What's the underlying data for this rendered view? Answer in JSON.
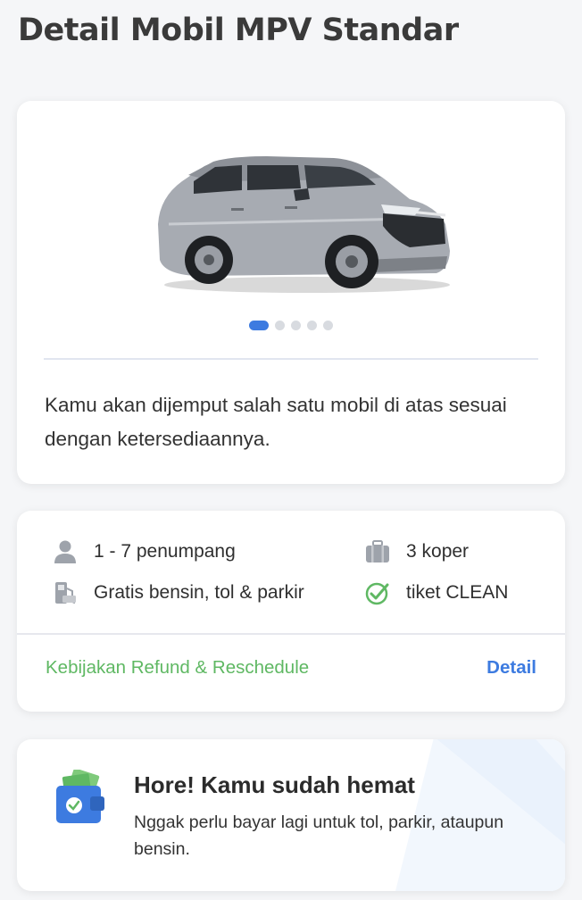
{
  "page": {
    "title": "Detail Mobil MPV Standar"
  },
  "car": {
    "image_icon": "mpv-car-image",
    "carousel": {
      "total": 5,
      "active_index": 0
    },
    "pickup_note": "Kamu akan dijemput salah satu mobil di atas sesuai dengan ketersediaannya."
  },
  "features": {
    "passengers": {
      "icon": "person-icon",
      "label": "1 - 7 penumpang"
    },
    "luggage": {
      "icon": "suitcase-icon",
      "label": "3 koper"
    },
    "fuel": {
      "icon": "fuel-pump-icon",
      "label": "Gratis bensin, tol & parkir"
    },
    "clean": {
      "icon": "check-circle-icon",
      "label": "tiket CLEAN"
    }
  },
  "links": {
    "refund": "Kebijakan Refund & Reschedule",
    "detail": "Detail"
  },
  "saving": {
    "icon": "wallet-icon",
    "title": "Hore! Kamu sudah hemat",
    "description": "Nggak perlu bayar lagi untuk tol, parkir, ataupun bensin."
  },
  "colors": {
    "accent_blue": "#3d7be0",
    "accent_green": "#5fb863",
    "icon_gray": "#9ea3ab"
  }
}
